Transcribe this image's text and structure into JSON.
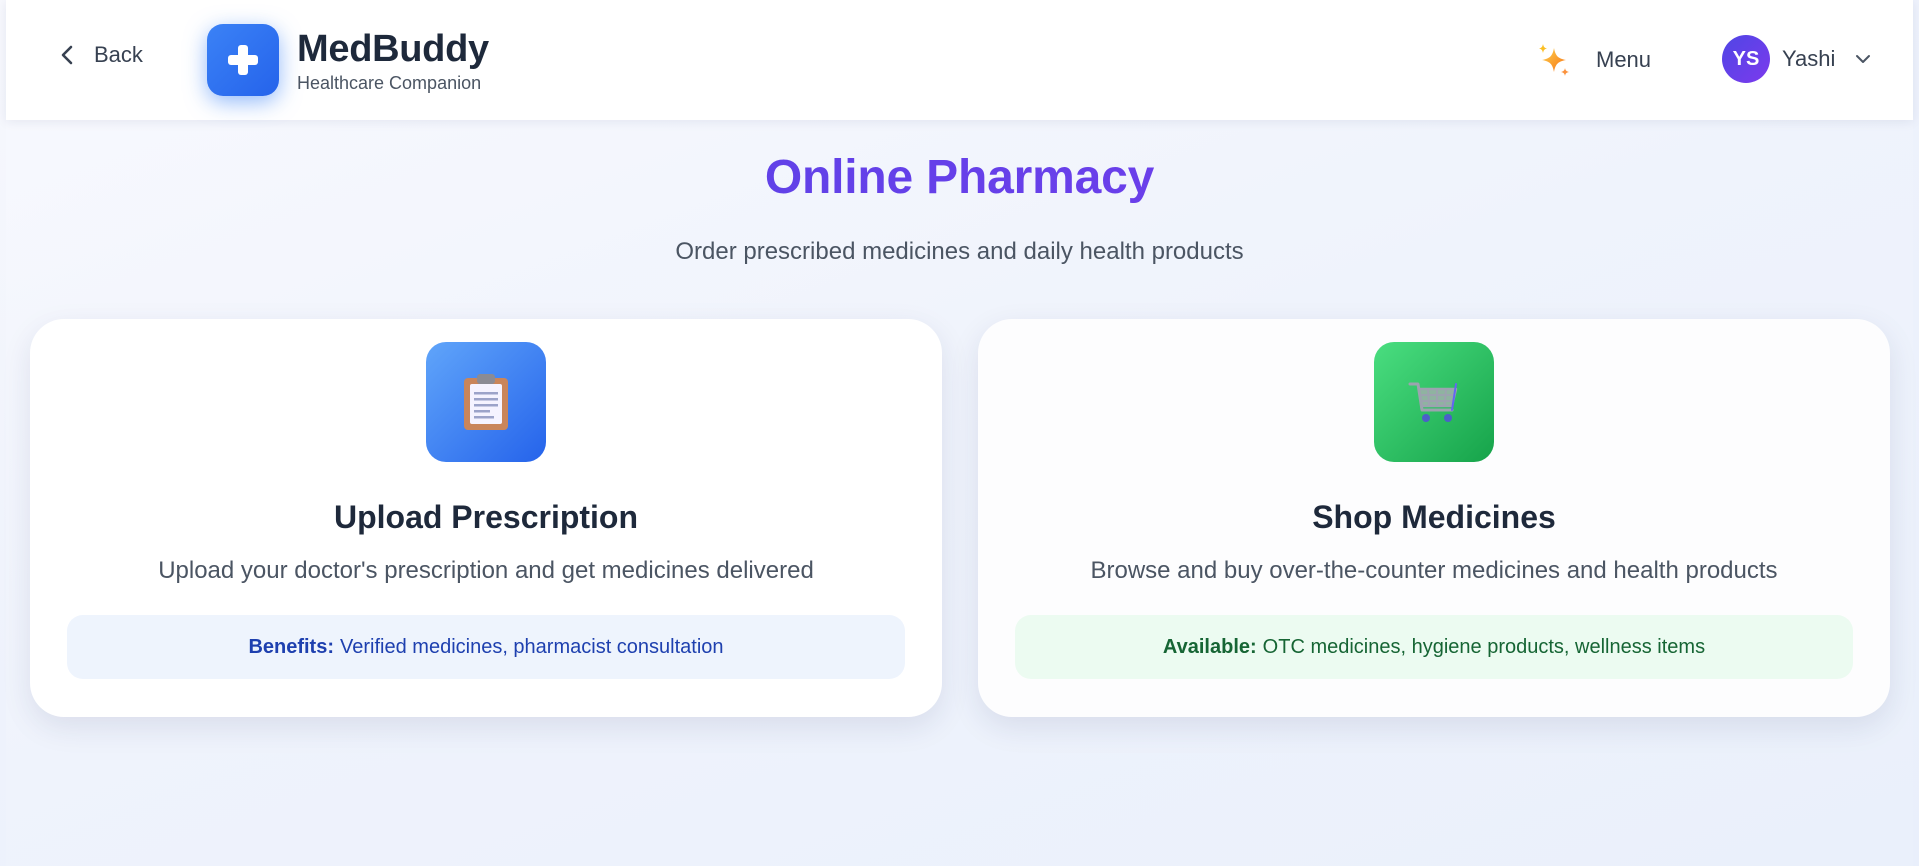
{
  "header": {
    "back_label": "Back",
    "brand_title": "MedBuddy",
    "brand_subtitle": "Healthcare Companion",
    "menu_label": "Menu",
    "user_initials": "YS",
    "user_name": "Yashi"
  },
  "main": {
    "title": "Online Pharmacy",
    "subtitle": "Order prescribed medicines and daily health products",
    "cards": [
      {
        "icon": "clipboard-icon",
        "title": "Upload Prescription",
        "description": "Upload your doctor's prescription and get medicines delivered",
        "note_label": "Benefits:",
        "note_text": "Verified medicines, pharmacist consultation",
        "accent": "#2563eb"
      },
      {
        "icon": "shopping-cart-icon",
        "title": "Shop Medicines",
        "description": "Browse and buy over-the-counter medicines and health products",
        "note_label": "Available:",
        "note_text": "OTC medicines, hygiene products, wellness items",
        "accent": "#16a34a"
      }
    ]
  },
  "colors": {
    "primary": "#3b82f6",
    "title_gradient_start": "#4f46e5",
    "title_gradient_end": "#7c3aed",
    "green": "#16a34a"
  }
}
